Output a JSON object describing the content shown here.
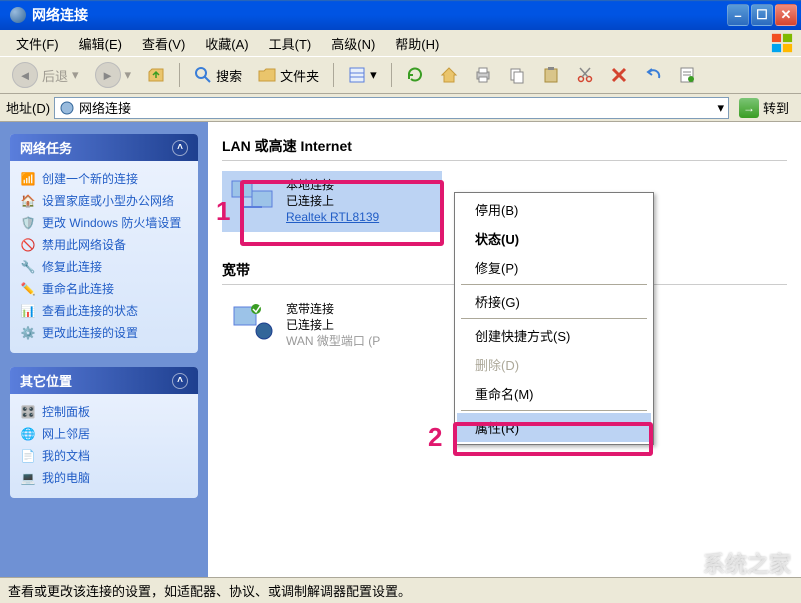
{
  "window": {
    "title": "网络连接"
  },
  "menu": {
    "file": "文件(F)",
    "edit": "编辑(E)",
    "view": "查看(V)",
    "favorites": "收藏(A)",
    "tools": "工具(T)",
    "advanced": "高级(N)",
    "help": "帮助(H)"
  },
  "toolbar": {
    "back": "后退",
    "search": "搜索",
    "folders": "文件夹"
  },
  "address": {
    "label": "地址(D)",
    "value": "网络连接",
    "go": "转到"
  },
  "sidebar": {
    "tasks_title": "网络任务",
    "tasks": [
      "创建一个新的连接",
      "设置家庭或小型办公网络",
      "更改 Windows 防火墙设置",
      "禁用此网络设备",
      "修复此连接",
      "重命名此连接",
      "查看此连接的状态",
      "更改此连接的设置"
    ],
    "other_title": "其它位置",
    "other": [
      "控制面板",
      "网上邻居",
      "我的文档",
      "我的电脑"
    ]
  },
  "main": {
    "section_lan": "LAN 或高速 Internet",
    "section_broadband": "宽带",
    "conn1": {
      "name": "本地连接",
      "status": "已连接上",
      "device": "Realtek RTL8139"
    },
    "conn2": {
      "name": "宽带连接",
      "status": "已连接上",
      "device": "WAN 微型端口 (P"
    }
  },
  "contextmenu": {
    "disable": "停用(B)",
    "status": "状态(U)",
    "repair": "修复(P)",
    "bridge": "桥接(G)",
    "shortcut": "创建快捷方式(S)",
    "delete": "删除(D)",
    "rename": "重命名(M)",
    "properties": "属性(R)"
  },
  "annotations": {
    "label1": "1",
    "label2": "2"
  },
  "statusbar": "查看或更改该连接的设置，如适配器、协议、或调制解调器配置设置。",
  "watermark": "系统之家"
}
